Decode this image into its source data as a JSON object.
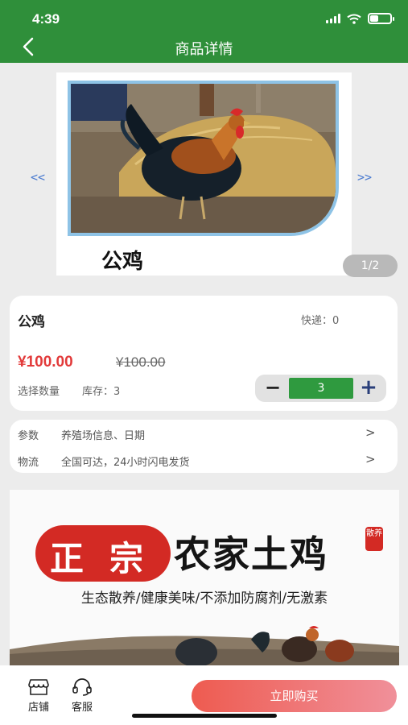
{
  "status_bar": {
    "time": "4:39"
  },
  "header": {
    "title": "商品详情",
    "back_icon": "chevron-left-icon"
  },
  "gallery": {
    "caption": "公鸡",
    "prev_label": "<<",
    "next_label": ">>",
    "page_indicator": "1/2",
    "frame_color": "#8ec3e6"
  },
  "product": {
    "name": "公鸡",
    "shipping": "快递：0",
    "price": "¥100.00",
    "original_price": "¥100.00",
    "quantity_label": "选择数量",
    "stock": "库存：3",
    "quantity": "3",
    "minus_label": "−",
    "plus_label": "+"
  },
  "info_rows": [
    {
      "key": "参数",
      "value": "养殖场信息、日期",
      "arrow": ">"
    },
    {
      "key": "物流",
      "value": "全国可达，24小时闪电发货",
      "arrow": ">"
    }
  ],
  "banner": {
    "badge_char1": "正",
    "badge_char2": "宗",
    "title": "农家土鸡",
    "seal_text": "散养",
    "subtitle": "生态散养/健康美味/不添加防腐剂/无激素"
  },
  "bottom_bar": {
    "shop_label": "店铺",
    "service_label": "客服",
    "buy_label": "立即购买"
  },
  "colors": {
    "header_green": "#2f8f3a",
    "price_red": "#e23a3a",
    "stepper_green": "#2f9a3f",
    "buy_gradient_start": "#ee5b50",
    "buy_gradient_end": "#f0909a"
  }
}
